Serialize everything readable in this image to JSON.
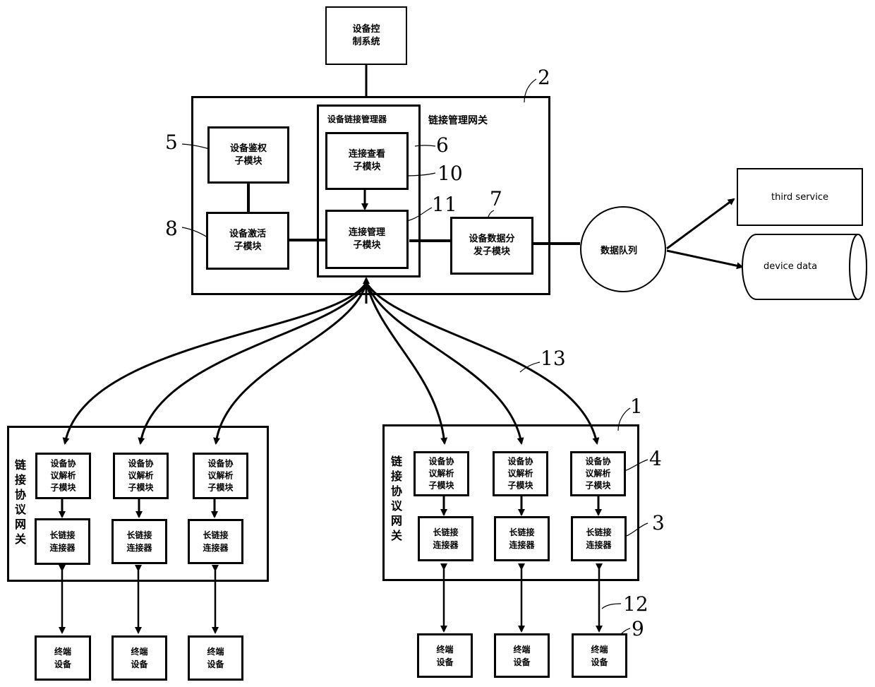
{
  "diagram": {
    "control_system": "设备控\n制系统",
    "gateway_mgmt": {
      "title": "链接管理网关",
      "ref": "2",
      "auth_module": {
        "label": "设备鉴权\n子模块",
        "ref": "5"
      },
      "activation_module": {
        "label": "设备激活\n子模块",
        "ref": "8"
      },
      "link_manager": {
        "title": "设备链接管理器",
        "ref": "6",
        "view_module": {
          "label": "连接查看\n子模块",
          "ref": "10"
        },
        "mgmt_module": {
          "label": "连接管理\n子模块",
          "ref": "11"
        }
      },
      "dispatch_module": {
        "label": "设备数据分\n发子模块",
        "ref": "7"
      }
    },
    "data_queue": "数据队列",
    "third_service": "third service",
    "device_data": "device data",
    "link_ref": "13",
    "protocol_gateways": [
      {
        "title": "链\n接\n协\n议\n网\n关",
        "ref": "",
        "parsers": [
          "设备协\n议解析\n子模块",
          "设备协\n议解析\n子模块",
          "设备协\n议解析\n子模块"
        ],
        "connectors": [
          "长链接\n连接器",
          "长链接\n连接器",
          "长链接\n连接器"
        ],
        "terminals": [
          "终端\n设备",
          "终端\n设备",
          "终端\n设备"
        ]
      },
      {
        "title": "链\n接\n协\n议\n网\n关",
        "ref": "1",
        "parser_ref": "4",
        "connector_ref": "3",
        "terminal_ref": "9",
        "line_ref": "12",
        "parsers": [
          "设备协\n议解析\n子模块",
          "设备协\n议解析\n子模块",
          "设备协\n议解析\n子模块"
        ],
        "connectors": [
          "长链接\n连接器",
          "长链接\n连接器",
          "长链接\n连接器"
        ],
        "terminals": [
          "终端\n设备",
          "终端\n设备",
          "终端\n设备"
        ]
      }
    ]
  }
}
